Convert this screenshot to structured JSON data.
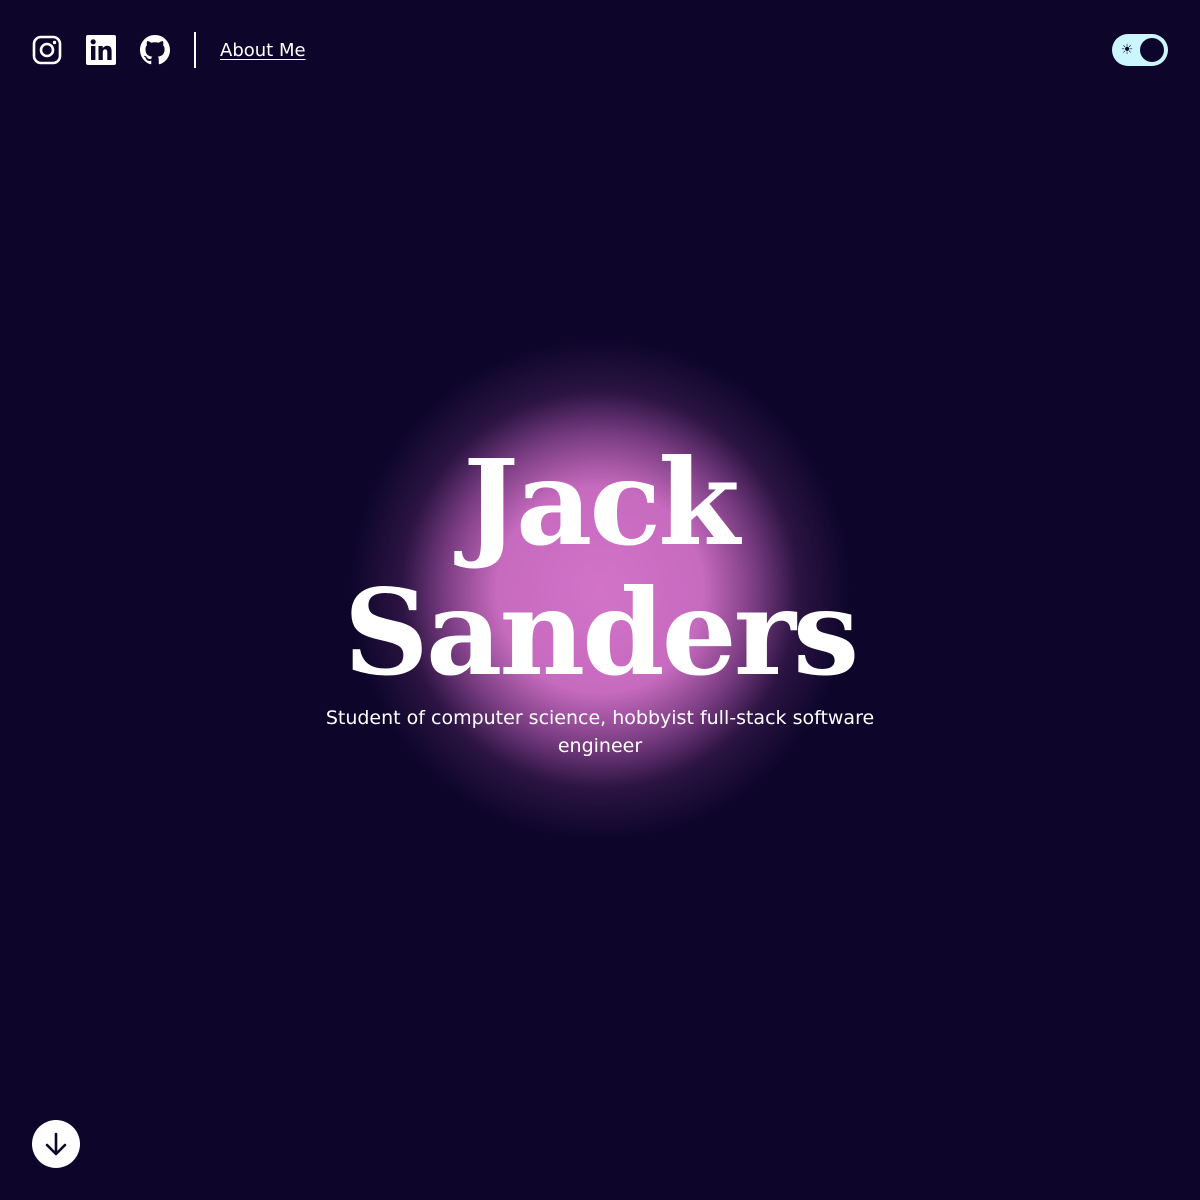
{
  "header": {
    "social_links": [
      {
        "name": "Instagram",
        "icon": "instagram-icon"
      },
      {
        "name": "LinkedIn",
        "icon": "linkedin-icon"
      },
      {
        "name": "GitHub",
        "icon": "github-icon"
      }
    ],
    "about_label": "About Me",
    "theme_toggle": {
      "icon": "sun-icon",
      "state": "light"
    }
  },
  "hero": {
    "first_name": "Jack",
    "last_name": "Sanders",
    "subtitle": "Student of computer science, hobbyist full-stack software engineer"
  },
  "scroll_button": {
    "icon": "arrow-down-icon"
  },
  "colors": {
    "background": "#0d062a",
    "glow": "#d273c8",
    "text": "#ffffff",
    "toggle_track": "#ccf6ff"
  }
}
